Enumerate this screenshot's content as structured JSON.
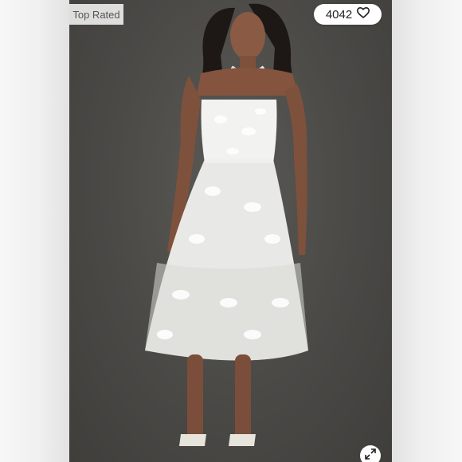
{
  "badge": {
    "text": "Top Rated"
  },
  "likes": {
    "count": "4042",
    "icon": "heart-icon"
  },
  "expand": {
    "icon": "expand-icon"
  },
  "photo": {
    "icon": "dress-model-photo"
  }
}
